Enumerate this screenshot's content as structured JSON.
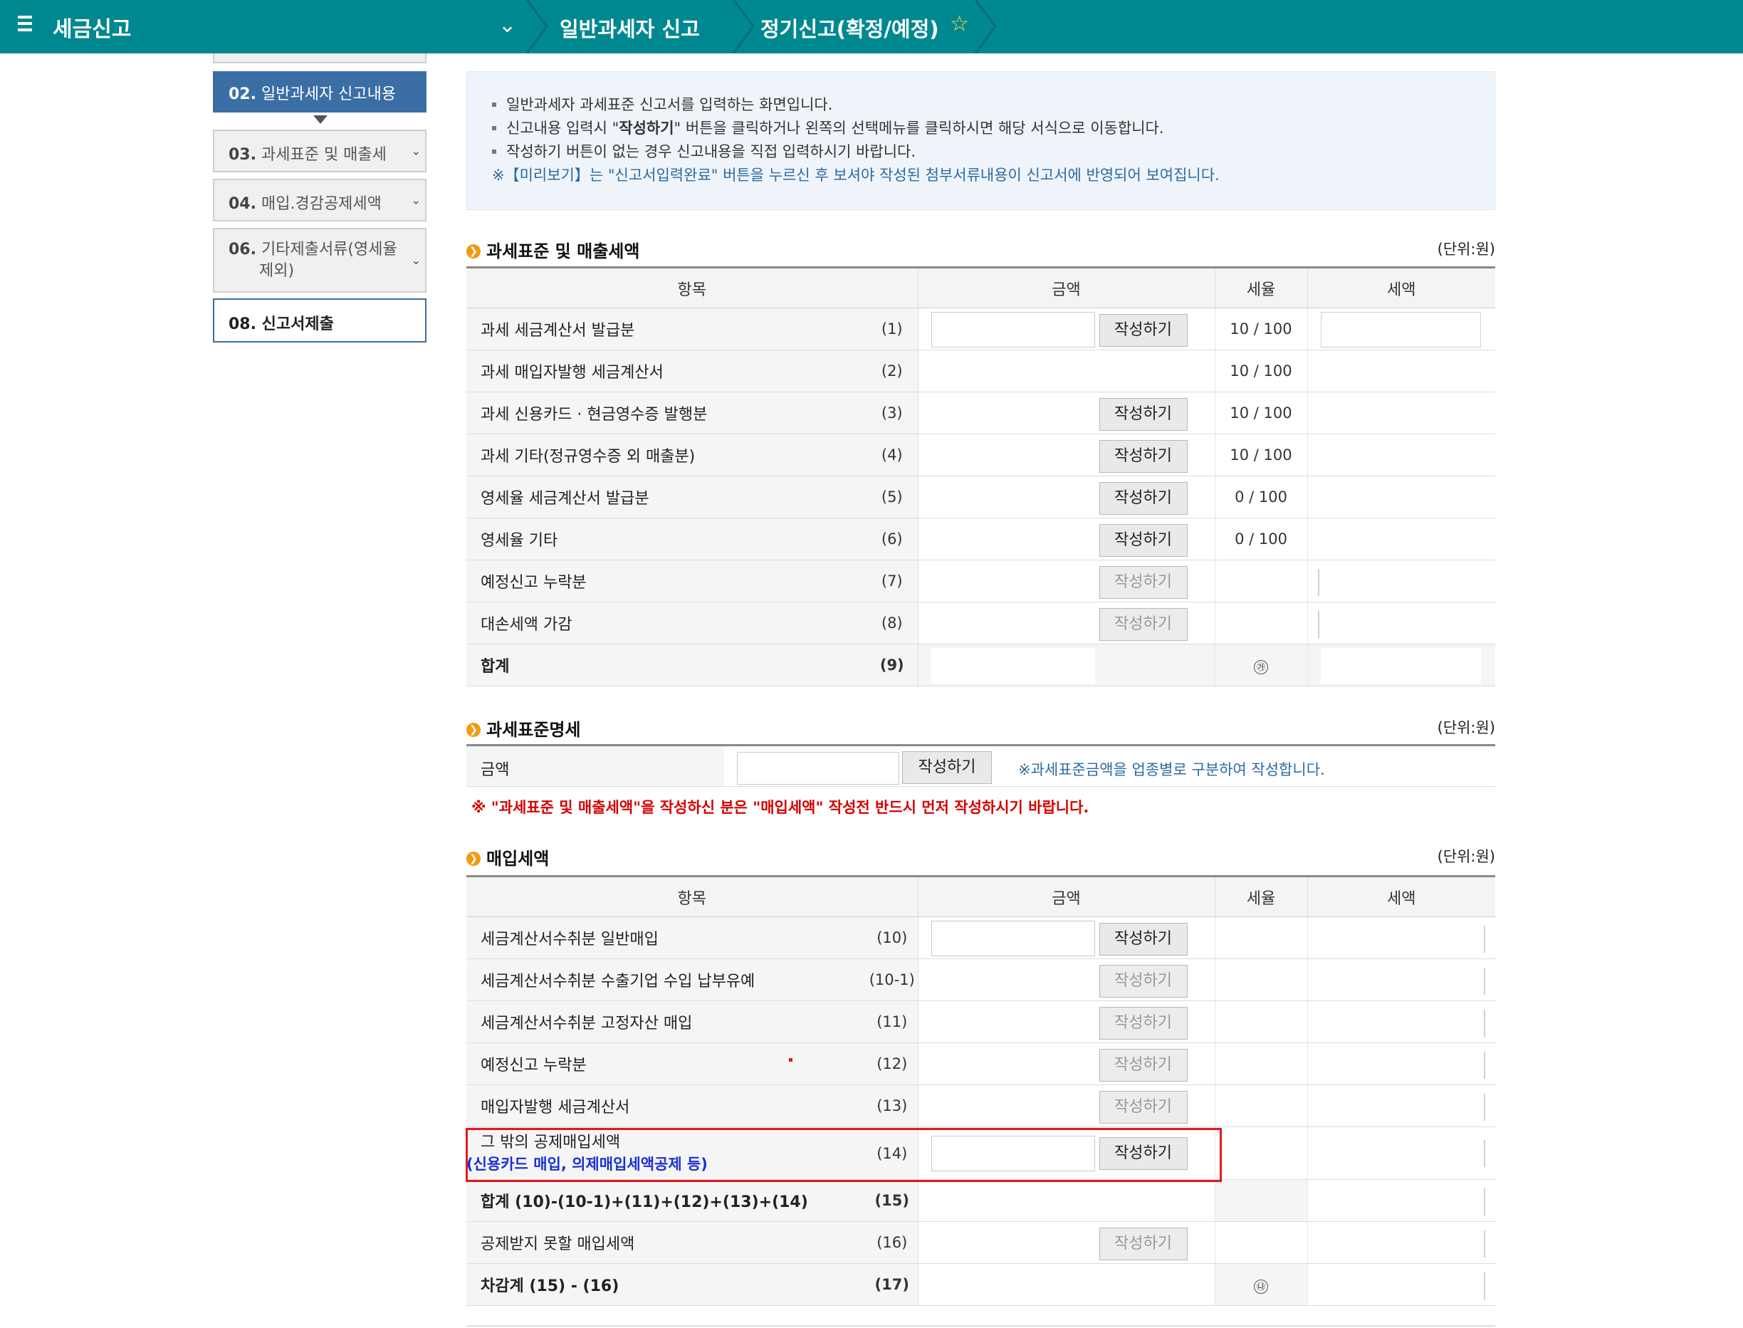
{
  "topbar": {
    "title": "세금신고",
    "crumb1": "일반과세자 신고",
    "crumb2": "정기신고(확정/예정)"
  },
  "sidebar": {
    "items": [
      {
        "num": "02.",
        "label": "일반과세자 신고내용"
      },
      {
        "num": "03.",
        "label": "과세표준 및 매출세"
      },
      {
        "num": "04.",
        "label": "매입.경감공제세액"
      },
      {
        "num": "06.",
        "label": "기타제출서류(영세율",
        "label2": "제외)"
      },
      {
        "num": "08.",
        "label": "신고서제출"
      }
    ]
  },
  "info": {
    "line1": "일반과세자 과세표준 신고서를 입력하는 화면입니다.",
    "line2_a": "신고내용 입력시 \"",
    "line2_b": "작성하기",
    "line2_c": "\" 버튼을 클릭하거나 왼쪽의 선택메뉴를 클릭하시면 해당 서식으로 이동합니다.",
    "line3": "작성하기 버튼이 없는 경우 신고내용을 직접 입력하시기 바랍니다.",
    "note": "※【미리보기】는 \"신고서입력완료\" 버튼을 누르신 후 보셔야 작성된 첨부서류내용이 신고서에 반영되어 보여집니다."
  },
  "common": {
    "unit": "(단위:원)",
    "col_item": "항목",
    "col_amount": "금액",
    "col_rate": "세율",
    "col_tax": "세액",
    "write": "작성하기"
  },
  "sales": {
    "title": "과세표준 및 매출세액",
    "rows": [
      {
        "label": "과세 세금계산서 발급분",
        "num": "(1)",
        "rate": "10 / 100"
      },
      {
        "label": "과세 매입자발행 세금계산서",
        "num": "(2)",
        "rate": "10 / 100"
      },
      {
        "label": "과세 신용카드 · 현금영수증 발행분",
        "num": "(3)",
        "rate": "10 / 100"
      },
      {
        "label": "과세 기타(정규영수증 외 매출분)",
        "num": "(4)",
        "rate": "10 / 100"
      },
      {
        "label": "영세율 세금계산서 발급분",
        "num": "(5)",
        "rate": "0 / 100"
      },
      {
        "label": "영세율 기타",
        "num": "(6)",
        "rate": "0 / 100"
      },
      {
        "label": "예정신고 누락분",
        "num": "(7)",
        "rate": ""
      },
      {
        "label": "대손세액 가감",
        "num": "(8)",
        "rate": ""
      },
      {
        "label": "합계",
        "num": "(9)",
        "rate": "㉮"
      }
    ]
  },
  "standard": {
    "title": "과세표준명세",
    "label": "금액",
    "hint": "※과세표준금액을 업종별로 구분하여 작성합니다.",
    "warning": "※ \"과세표준 및 매출세액\"을 작성하신 분은 \"매입세액\" 작성전 반드시 먼저 작성하시기 바랍니다."
  },
  "purchase": {
    "title": "매입세액",
    "rows": [
      {
        "label": "세금계산서수취분 일반매입",
        "num": "(10)"
      },
      {
        "label": "세금계산서수취분 수출기업 수입 납부유예",
        "num": "(10-1)"
      },
      {
        "label": "세금계산서수취분 고정자산 매입",
        "num": "(11)"
      },
      {
        "label": "예정신고 누락분",
        "num": "(12)"
      },
      {
        "label": "매입자발행 세금계산서",
        "num": "(13)"
      },
      {
        "label": "그 밖의 공제매입세액",
        "sub": "(신용카드 매입, 의제매입세액공제 등)",
        "num": "(14)"
      },
      {
        "label": "합계 (10)-(10-1)+(11)+(12)+(13)+(14)",
        "num": "(15)"
      },
      {
        "label": "공제받지 못할 매입세액",
        "num": "(16)"
      },
      {
        "label": "차감계 (15) - (16)",
        "num": "(17)",
        "rate": "㉯"
      }
    ]
  }
}
